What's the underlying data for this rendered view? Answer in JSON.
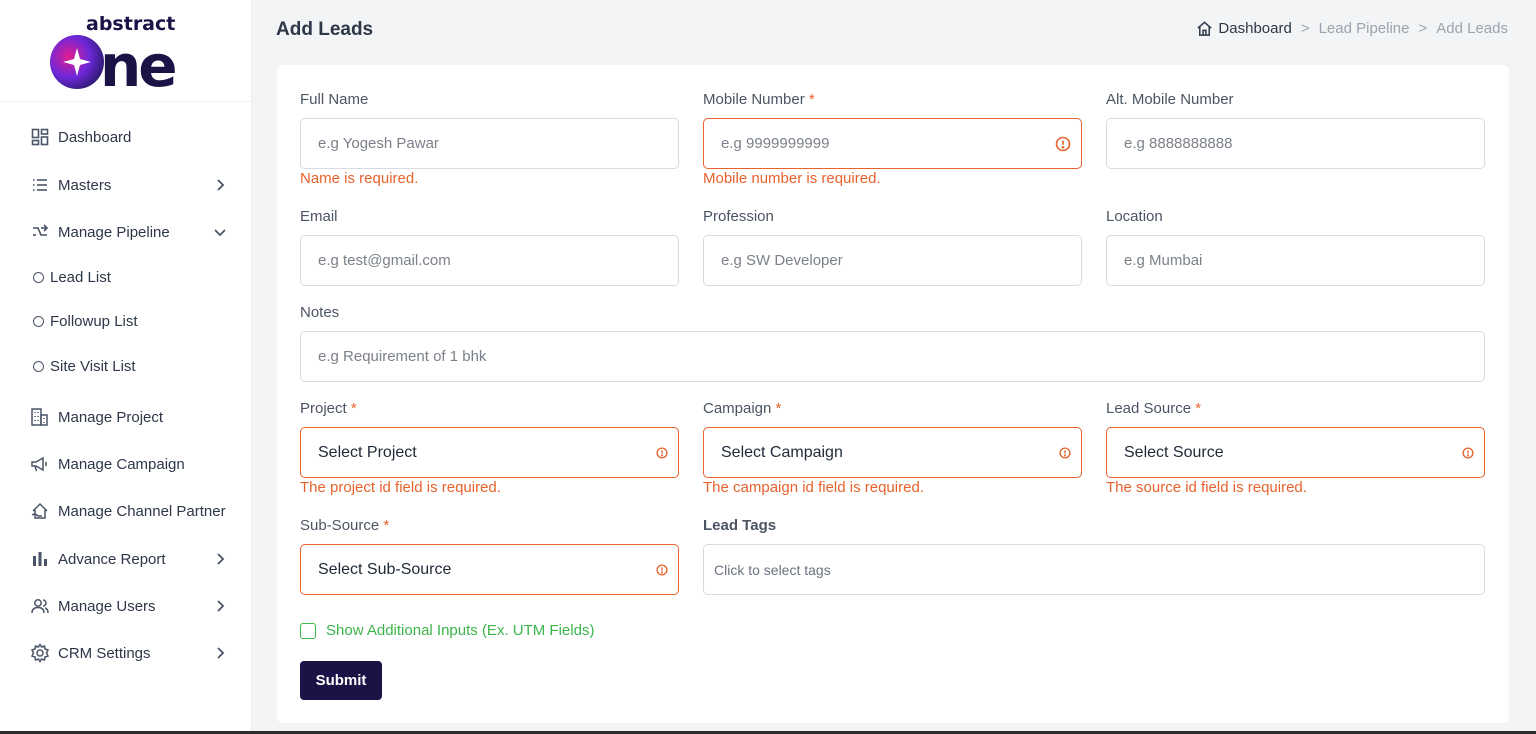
{
  "logo": {
    "text_top": "abstract",
    "text_main": "one"
  },
  "sidebar": {
    "items": [
      {
        "label": "Dashboard",
        "icon": "dashboard-grid-icon"
      },
      {
        "label": "Masters",
        "icon": "list-icon"
      },
      {
        "label": "Manage Pipeline",
        "icon": "pipeline-icon"
      },
      {
        "label": "Manage Project",
        "icon": "building-icon"
      },
      {
        "label": "Manage Campaign",
        "icon": "megaphone-icon"
      },
      {
        "label": "Manage Channel Partner",
        "icon": "house-partner-icon"
      },
      {
        "label": "Advance Report",
        "icon": "bar-chart-icon"
      },
      {
        "label": "Manage Users",
        "icon": "users-icon"
      },
      {
        "label": "CRM Settings",
        "icon": "gear-icon"
      }
    ],
    "pipeline_sub": [
      "Lead List",
      "Followup List",
      "Site Visit List"
    ]
  },
  "header": {
    "title": "Add Leads",
    "breadcrumb": {
      "home": "Dashboard",
      "sep": ">",
      "middle": "Lead Pipeline",
      "current": "Add Leads"
    }
  },
  "form": {
    "full_name": {
      "label": "Full Name",
      "placeholder": "e.g Yogesh Pawar",
      "error": "Name is required."
    },
    "mobile": {
      "label": "Mobile Number",
      "req": "*",
      "placeholder": "e.g 9999999999",
      "error": "Mobile number is required."
    },
    "alt_mobile": {
      "label": "Alt. Mobile Number",
      "placeholder": "e.g 8888888888"
    },
    "email": {
      "label": "Email",
      "placeholder": "e.g test@gmail.com"
    },
    "profession": {
      "label": "Profession",
      "placeholder": "e.g SW Developer"
    },
    "location": {
      "label": "Location",
      "placeholder": "e.g Mumbai"
    },
    "notes": {
      "label": "Notes",
      "placeholder": "e.g Requirement of 1 bhk"
    },
    "project": {
      "label": "Project",
      "req": "*",
      "value": "Select Project",
      "error": "The project id field is required."
    },
    "campaign": {
      "label": "Campaign",
      "req": "*",
      "value": "Select Campaign",
      "error": "The campaign id field is required."
    },
    "lead_source": {
      "label": "Lead Source",
      "req": "*",
      "value": "Select Source",
      "error": "The source id field is required."
    },
    "sub_source": {
      "label": "Sub-Source",
      "req": "*",
      "value": "Select Sub-Source"
    },
    "lead_tags": {
      "label": "Lead Tags",
      "placeholder": "Click to select tags"
    },
    "additional_inputs_label": "Show Additional Inputs (Ex. UTM Fields)",
    "submit_label": "Submit"
  },
  "colors": {
    "accent_error": "#e8622c",
    "submit_bg": "#1a1446",
    "success_green": "#3cb44b"
  }
}
